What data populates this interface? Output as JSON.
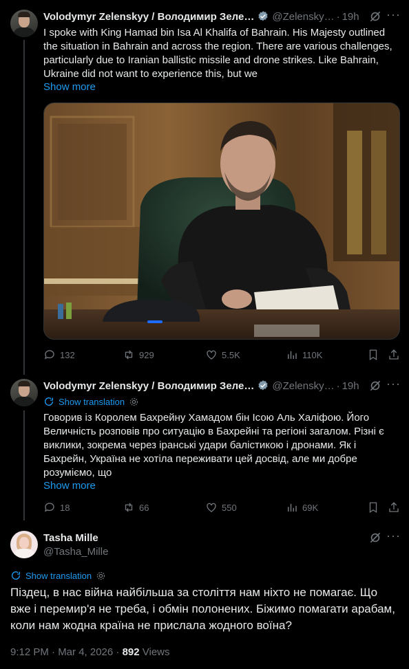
{
  "post1": {
    "name": "Volodymyr Zelenskyy / Володимир Зеле…",
    "handle": "@Zelensky…",
    "time": "19h",
    "text": "I spoke with King Hamad bin Isa Al Khalifa of Bahrain. His Majesty outlined the situation in Bahrain and across the region. There are various challenges, particularly due to Iranian ballistic missile and drone strikes. Like Bahrain, Ukraine did not want to experience this, but we",
    "show_more": "Show more",
    "replies": "132",
    "reposts": "929",
    "likes": "5.5K",
    "views": "110K"
  },
  "post2": {
    "name": "Volodymyr Zelenskyy / Володимир Зеле…",
    "handle": "@Zelensky…",
    "time": "19h",
    "show_translation": "Show translation",
    "text": "Говорив із Королем Бахрейну Хамадом бін Ісою Аль Халіфою. Його Величність розповів про ситуацію в Бахрейні та регіоні загалом. Різні є виклики, зокрема через іранські удари балістикою і дронами. Як і Бахрейн, Україна не хотіла переживати цей досвід, але ми добре розуміємо, що",
    "show_more": "Show more",
    "replies": "18",
    "reposts": "66",
    "likes": "550",
    "views": "69K"
  },
  "post3": {
    "name": "Tasha Mille",
    "handle": "@Tasha_Mille",
    "show_translation": "Show translation",
    "text": "Піздец, в нас війна найбільша за століття нам ніхто не помагає. Що вже і перемир'я не треба, і обмін полонених. Біжимо помагати арабам, коли нам жодна країна не прислала жодного воїна?",
    "timestamp": "9:12 PM · Mar 4, 2026 · ",
    "views_count": "892",
    "views_label": " Views"
  },
  "colors": {
    "accent": "#1d9bf0",
    "muted": "#71767b",
    "text": "#e7e9ea",
    "background": "#000000"
  },
  "icons": [
    "verified-badge-icon",
    "grok-icon",
    "more-icon",
    "reply-icon",
    "repost-icon",
    "like-icon",
    "views-icon",
    "bookmark-icon",
    "share-icon",
    "translate-icon",
    "gear-icon"
  ]
}
